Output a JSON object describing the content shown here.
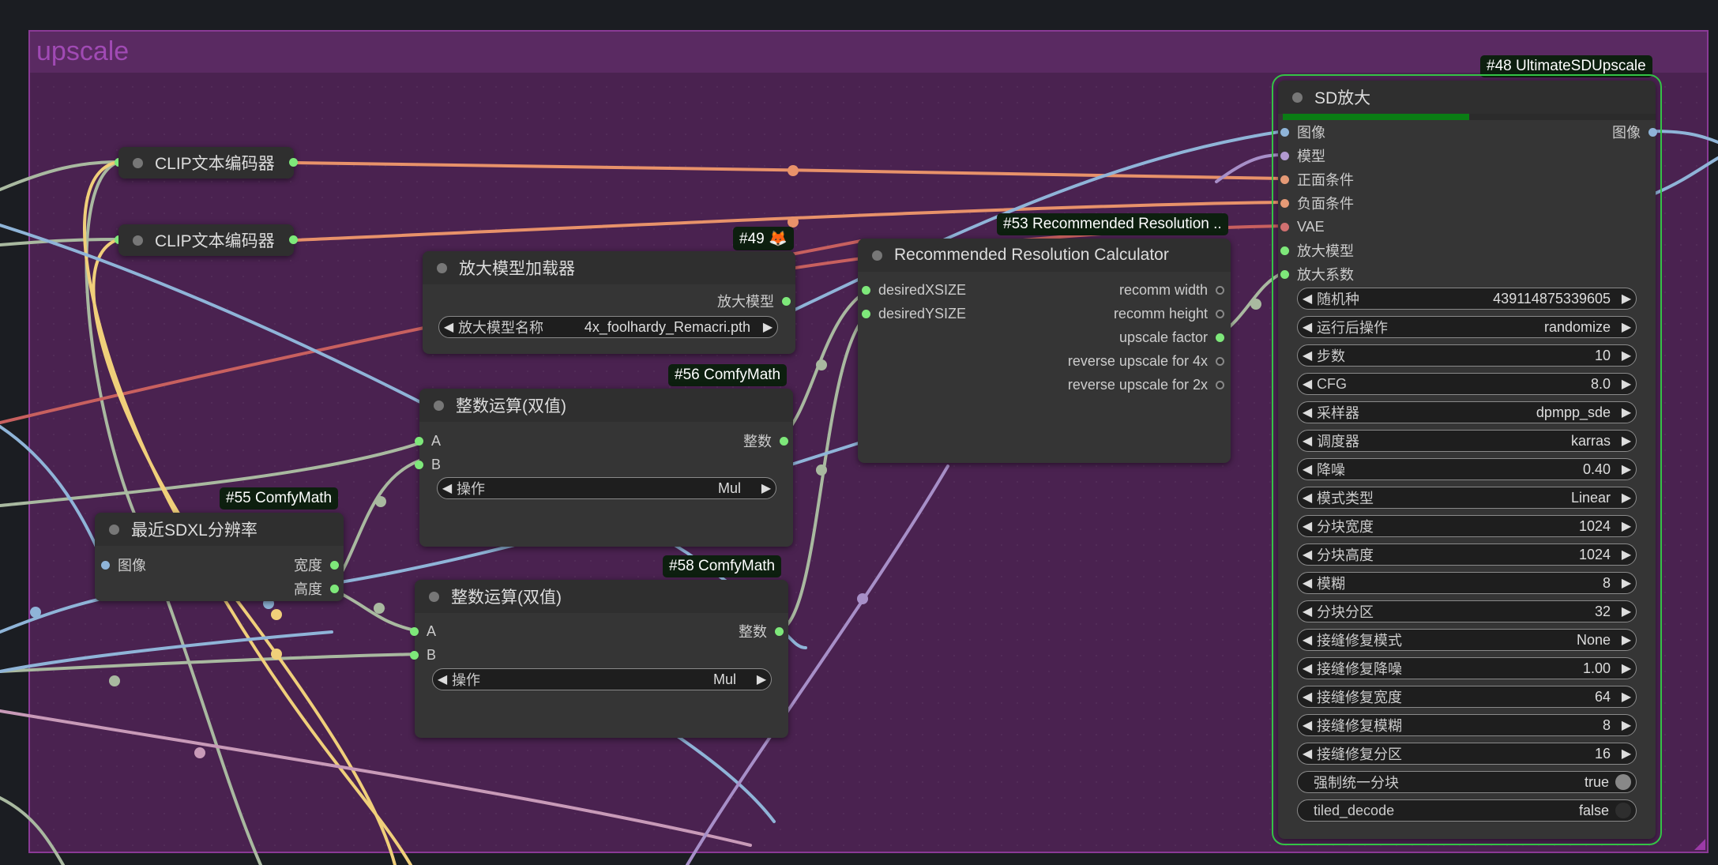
{
  "group": {
    "title": "upscale"
  },
  "clip_nodes": [
    {
      "title": "CLIP文本编码器"
    },
    {
      "title": "CLIP文本编码器"
    }
  ],
  "upscale_loader": {
    "badge": "#49 🦊",
    "title": "放大模型加载器",
    "output": "放大模型",
    "widget_label": "放大模型名称",
    "widget_value": "4x_foolhardy_Remacri.pth"
  },
  "math56": {
    "badge": "#56 ComfyMath",
    "title": "整数运算(双值)",
    "inputs": [
      "A",
      "B"
    ],
    "output": "整数",
    "widget_label": "操作",
    "widget_value": "Mul"
  },
  "math58": {
    "badge": "#58 ComfyMath",
    "title": "整数运算(双值)",
    "inputs": [
      "A",
      "B"
    ],
    "output": "整数",
    "widget_label": "操作",
    "widget_value": "Mul"
  },
  "sdxl55": {
    "badge": "#55 ComfyMath",
    "title": "最近SDXL分辨率",
    "input": "图像",
    "outputs": [
      "宽度",
      "高度"
    ]
  },
  "rrc53": {
    "badge": "#53 Recommended Resolution ..",
    "title": "Recommended Resolution Calculator",
    "inputs": [
      "desiredXSIZE",
      "desiredYSIZE"
    ],
    "outputs": [
      "recomm width",
      "recomm height",
      "upscale factor",
      "reverse upscale for 4x",
      "reverse upscale for 2x"
    ]
  },
  "sd48": {
    "badge": "#48 UltimateSDUpscale",
    "title": "SD放大",
    "inputs": [
      "图像",
      "模型",
      "正面条件",
      "负面条件",
      "VAE",
      "放大模型",
      "放大系数"
    ],
    "output": "图像",
    "progress": 0.5,
    "widgets": [
      {
        "label": "随机种",
        "value": "439114875339605"
      },
      {
        "label": "运行后操作",
        "value": "randomize"
      },
      {
        "label": "步数",
        "value": "10"
      },
      {
        "label": "CFG",
        "value": "8.0"
      },
      {
        "label": "采样器",
        "value": "dpmpp_sde"
      },
      {
        "label": "调度器",
        "value": "karras"
      },
      {
        "label": "降噪",
        "value": "0.40"
      },
      {
        "label": "模式类型",
        "value": "Linear"
      },
      {
        "label": "分块宽度",
        "value": "1024"
      },
      {
        "label": "分块高度",
        "value": "1024"
      },
      {
        "label": "模糊",
        "value": "8"
      },
      {
        "label": "分块分区",
        "value": "32"
      },
      {
        "label": "接缝修复模式",
        "value": "None"
      },
      {
        "label": "接缝修复降噪",
        "value": "1.00"
      },
      {
        "label": "接缝修复宽度",
        "value": "64"
      },
      {
        "label": "接缝修复模糊",
        "value": "8"
      },
      {
        "label": "接缝修复分区",
        "value": "16"
      }
    ],
    "toggles": [
      {
        "label": "强制统一分块",
        "value": "true"
      },
      {
        "label": "tiled_decode",
        "value": "false"
      }
    ]
  },
  "colors": {
    "group_bg": "#4a2250",
    "wire_orange": "#e8926a",
    "wire_blue": "#8fb4d8",
    "wire_green": "#a9b9a0",
    "wire_yellow": "#f0cf7a",
    "wire_purple": "#a78fc8",
    "wire_red": "#c8605f",
    "selected": "#34c246"
  }
}
